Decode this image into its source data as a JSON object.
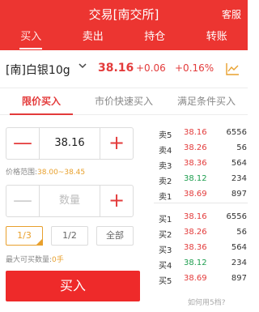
{
  "header": {
    "title": "交易[南交所]",
    "service": "客服"
  },
  "tabs": [
    "买入",
    "卖出",
    "持仓",
    "转账"
  ],
  "product": {
    "name": "[南]白银10g",
    "price": "38.16",
    "change": "+0.06",
    "change_pct": "+0.16%"
  },
  "subtabs": [
    "限价买入",
    "市价快速买入",
    "满足条件买入"
  ],
  "price_stepper": {
    "value": "38.16"
  },
  "price_range": {
    "label": "价格范围:",
    "value": "38.00~38.45"
  },
  "qty_stepper": {
    "placeholder": "数量"
  },
  "fractions": [
    "1/3",
    "1/2",
    "全部"
  ],
  "max_qty": {
    "label": "最大可买数量:",
    "value": "0手"
  },
  "buy_button": "买入",
  "help_link": "如何用5档?",
  "order_book": {
    "asks": [
      {
        "label": "卖5",
        "price": "38.16",
        "trend": "up",
        "volume": "6556"
      },
      {
        "label": "卖4",
        "price": "38.26",
        "trend": "up",
        "volume": "56"
      },
      {
        "label": "卖3",
        "price": "38.36",
        "trend": "up",
        "volume": "564"
      },
      {
        "label": "卖2",
        "price": "38.12",
        "trend": "down",
        "volume": "234"
      },
      {
        "label": "卖1",
        "price": "38.69",
        "trend": "up",
        "volume": "897"
      }
    ],
    "bids": [
      {
        "label": "买1",
        "price": "38.16",
        "trend": "up",
        "volume": "6556"
      },
      {
        "label": "买2",
        "price": "38.26",
        "trend": "up",
        "volume": "56"
      },
      {
        "label": "买3",
        "price": "38.36",
        "trend": "up",
        "volume": "564"
      },
      {
        "label": "买4",
        "price": "38.12",
        "trend": "down",
        "volume": "234"
      },
      {
        "label": "买5",
        "price": "38.69",
        "trend": "up",
        "volume": "897"
      }
    ]
  },
  "colors": {
    "brand": "#ec3531",
    "up": "#e33b3b",
    "down": "#1e9e4f",
    "accent": "#e8a02d"
  }
}
